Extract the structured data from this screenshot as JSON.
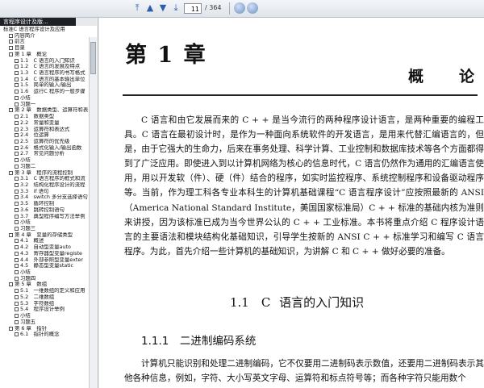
{
  "toolbar": {
    "current_page": "11",
    "total_pages": "/ 364"
  },
  "sidebar": {
    "tab_title": "言程序设计及版...",
    "items": [
      {
        "level": 1,
        "label": "标准C 语言程序设计及应用"
      },
      {
        "level": 2,
        "label": "内容简介"
      },
      {
        "level": 2,
        "label": "前言"
      },
      {
        "level": 2,
        "label": "目录"
      },
      {
        "level": 2,
        "label": "第 1 章　概论"
      },
      {
        "level": 3,
        "label": "1.1　C 语言的入门知识"
      },
      {
        "level": 3,
        "label": "1.2　C 语言的发展及特点"
      },
      {
        "level": 3,
        "label": "1.3　C 语言程序的书写格式"
      },
      {
        "level": 3,
        "label": "1.4　C 语言的基本输出单位"
      },
      {
        "level": 3,
        "label": "1.5　简单的输入/输出"
      },
      {
        "level": 3,
        "label": "1.6　运行C 程序的一般步骤"
      },
      {
        "level": 3,
        "label": "小结"
      },
      {
        "level": 3,
        "label": "习题一"
      },
      {
        "level": 2,
        "label": "第 2 章　数据类型、运算符和表"
      },
      {
        "level": 3,
        "label": "2.1　数据类型"
      },
      {
        "level": 3,
        "label": "2.2　常量和变量"
      },
      {
        "level": 3,
        "label": "2.3　运算符和表达式"
      },
      {
        "level": 3,
        "label": "2.4　位运算"
      },
      {
        "level": 3,
        "label": "2.5　运算符的优先级"
      },
      {
        "level": 3,
        "label": "2.6　格式化输入/输出函数"
      },
      {
        "level": 3,
        "label": "2.7　常见问题分析"
      },
      {
        "level": 3,
        "label": "小结"
      },
      {
        "level": 3,
        "label": "习题二"
      },
      {
        "level": 2,
        "label": "第 3 章　程序的流程控制"
      },
      {
        "level": 3,
        "label": "3.1　C 语言程序的框式和流"
      },
      {
        "level": 3,
        "label": "3.2　结构化程序设计的流程"
      },
      {
        "level": 3,
        "label": "3.3　if 语句"
      },
      {
        "level": 3,
        "label": "3.4　switch 多分支选择语句"
      },
      {
        "level": 3,
        "label": "3.5　循环控制"
      },
      {
        "level": 3,
        "label": "3.6　跳转控制语句"
      },
      {
        "level": 3,
        "label": "3.7　典型程序编写方法举例"
      },
      {
        "level": 3,
        "label": "小结"
      },
      {
        "level": 3,
        "label": "习题三"
      },
      {
        "level": 2,
        "label": "第 4 章　变量的存储类型"
      },
      {
        "level": 3,
        "label": "4.1　概述"
      },
      {
        "level": 3,
        "label": "4.2　自动型变量auto"
      },
      {
        "level": 3,
        "label": "4.3　寄存器型变量registe"
      },
      {
        "level": 3,
        "label": "4.4　外部参照型变量exter"
      },
      {
        "level": 3,
        "label": "4.5　静态型变量static"
      },
      {
        "level": 3,
        "label": "小结"
      },
      {
        "level": 3,
        "label": "习题四"
      },
      {
        "level": 2,
        "label": "第 5 章　数组"
      },
      {
        "level": 3,
        "label": "5.1　一维数组的定义和应用"
      },
      {
        "level": 3,
        "label": "5.2　二维数组"
      },
      {
        "level": 3,
        "label": "5.3　字符数组"
      },
      {
        "level": 3,
        "label": "5.4　程序设计举例"
      },
      {
        "level": 3,
        "label": "小结"
      },
      {
        "level": 3,
        "label": "习题五"
      },
      {
        "level": 2,
        "label": "第 6 章　指针"
      },
      {
        "level": 3,
        "label": "6.1　指针的概念"
      }
    ]
  },
  "document": {
    "chapter_heading": "第 1 章",
    "chapter_subtitle": "概论",
    "paragraph": "C 语言和由它发展而来的 C + + 是当今流行的两种程序设计语言，是两种重要的编程工具。C 语言在最初设计时，是作为一种面向系统软件的开发语言，是用来代替汇编语言的，但是，由于它强大的生命力，后来在事务处理、科学计算、工业控制和数据库技术等各个方面都得到了广泛应用。即使进入到以计算机网络为核心的信息时代，C 语言仍然作为通用的汇编语言使用，用以开发软（件）、硬（件）结合的程序，如实时监控程序、系统控制程序和设备驱动程序等。当前，作为理工科各专业本科生的计算机基础课程“C 语言程序设计”应按照最新的 ANSI（America National Standard Institute，美国国家标准局）C + + 标准的基础内核为准则来讲授，因为该标准已成为当今世界公认的 C + + 工业标准。本书将重点介绍 C 程序设计语言的主要语法和模块结构化基础知识，引导学生按新的 ANSI C + + 标准学习和编写 C 语言程序。为此，首先介绍一些计算机的基础知识，为讲解 C 和 C + + 做好必要的准备。",
    "section_heading": "1.1　C 语言的入门知识",
    "subsection_heading": "1.1.1　二进制编码系统",
    "paragraph2": "计算机只能识别和处理二进制编码，它不仅要用二进制码表示数值，还要用二进制码表示其他各种信息，例如，字符、大小写英文字母、运算符和标点符号等；而各种字符只能用数个"
  }
}
